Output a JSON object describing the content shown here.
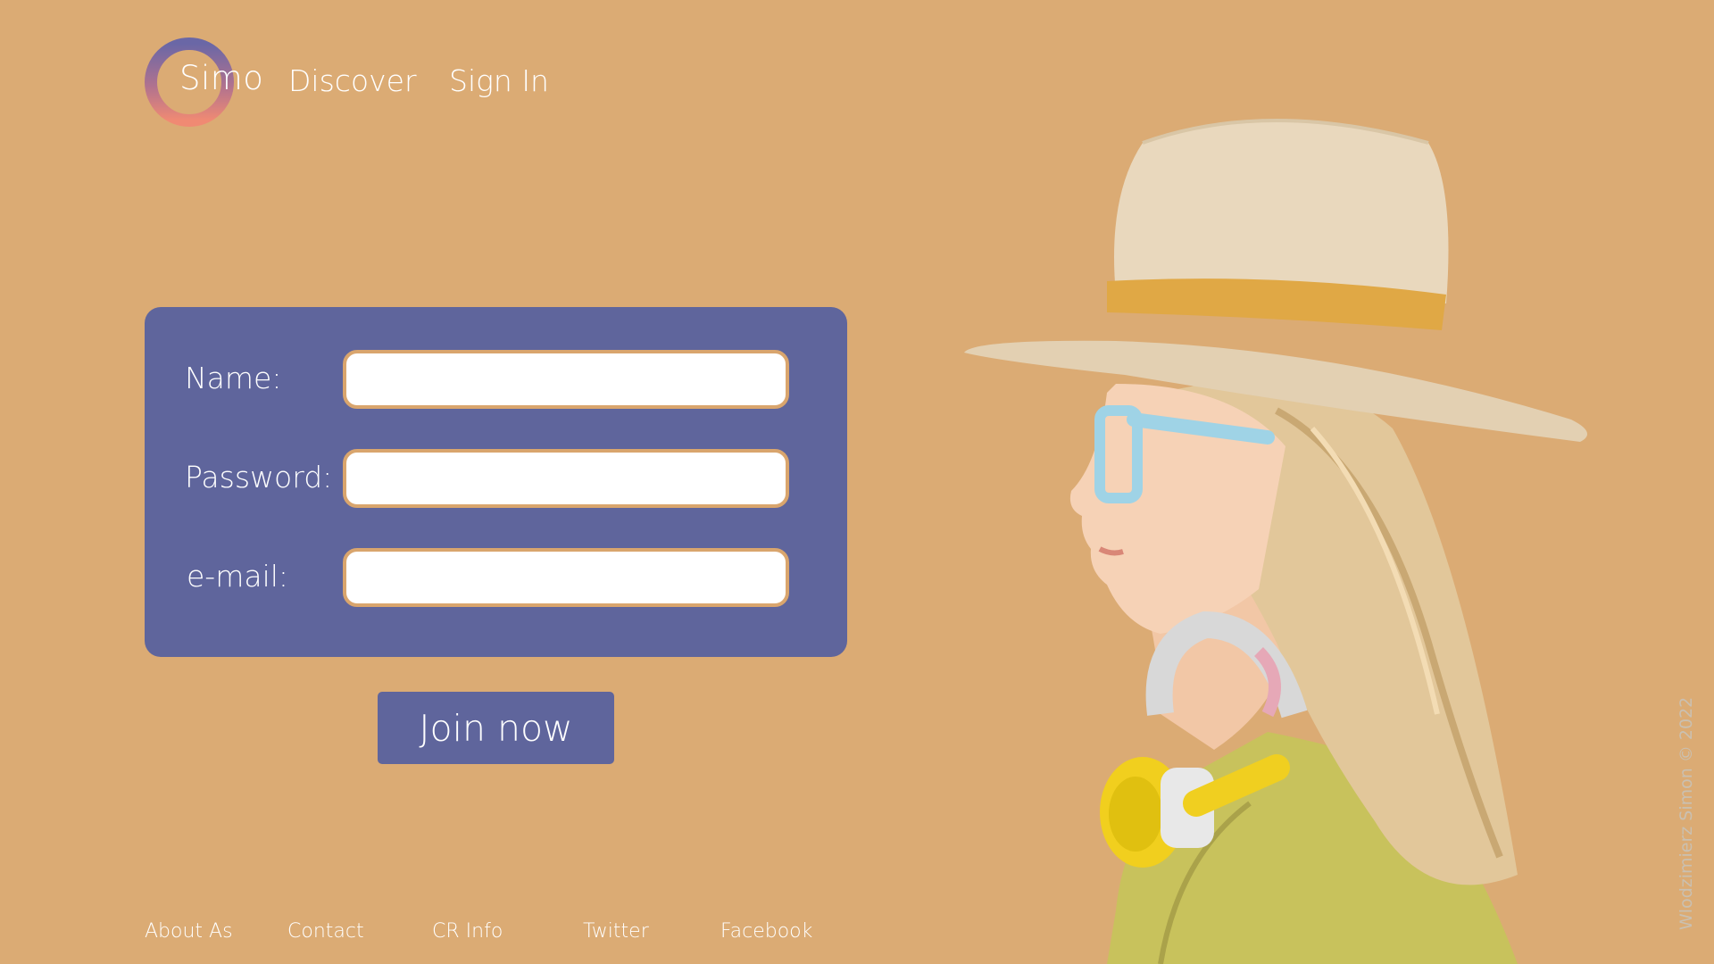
{
  "header": {
    "logo_text": "Simo",
    "nav": [
      "Discover",
      "Sign In"
    ]
  },
  "form": {
    "fields": [
      {
        "label": "Name:",
        "value": "",
        "placeholder": ""
      },
      {
        "label": "Password:",
        "value": "",
        "placeholder": ""
      },
      {
        "label": "e-mail:",
        "value": "",
        "placeholder": ""
      }
    ],
    "submit_label": "Join now"
  },
  "footer": {
    "links": [
      "About As",
      "Contact",
      "CR Info",
      "Twitter",
      "Facebook"
    ]
  },
  "credit": "Wlodzimierz Simon © 2022",
  "colors": {
    "background": "#dbab74",
    "card": "#5f659c",
    "button": "#5f659c",
    "input_border": "#d9a56d",
    "text": "#ffffff"
  },
  "icons": {
    "logo": "gradient-ring-logo"
  }
}
